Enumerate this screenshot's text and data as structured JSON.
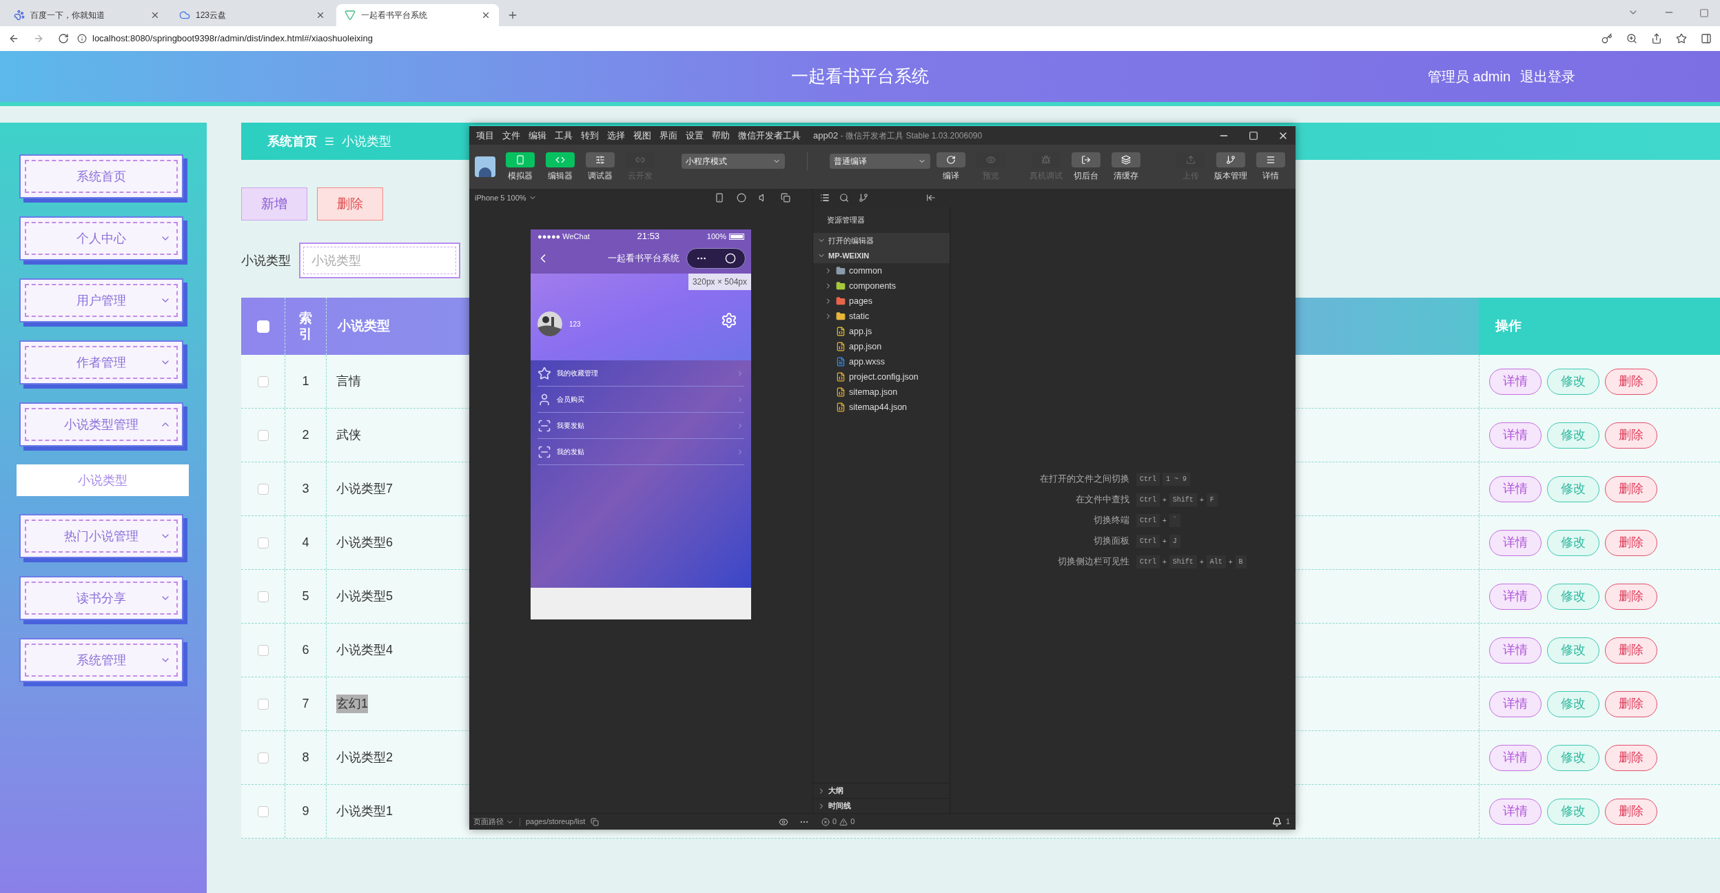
{
  "browser": {
    "tabs": [
      {
        "title": "百度一下，你就知道",
        "selected": false
      },
      {
        "title": "123云盘",
        "selected": false
      },
      {
        "title": "一起看书平台系统",
        "selected": true
      }
    ],
    "address": "localhost:8080/springboot9398r/admin/dist/index.html#/xiaoshuoleixing"
  },
  "header": {
    "title": "一起看书平台系统",
    "user": "管理员 admin",
    "logout": "退出登录"
  },
  "sidebar": {
    "items": [
      {
        "label": "系统首页",
        "kind": "link"
      },
      {
        "label": "个人中心",
        "kind": "menu",
        "expanded": false
      },
      {
        "label": "用户管理",
        "kind": "menu",
        "expanded": false
      },
      {
        "label": "作者管理",
        "kind": "menu",
        "expanded": false
      },
      {
        "label": "小说类型管理",
        "kind": "menu",
        "expanded": true,
        "children": [
          {
            "label": "小说类型",
            "selected": true
          }
        ]
      },
      {
        "label": "热门小说管理",
        "kind": "menu",
        "expanded": false
      },
      {
        "label": "读书分享",
        "kind": "menu",
        "expanded": false
      },
      {
        "label": "系统管理",
        "kind": "menu",
        "expanded": false
      }
    ]
  },
  "breadcrumb": {
    "home": "系统首页",
    "current": "小说类型"
  },
  "actions": [
    {
      "label": "新增",
      "kind": "add"
    },
    {
      "label": "删除",
      "kind": "delete"
    }
  ],
  "search": {
    "label": "小说类型",
    "placeholder": "小说类型"
  },
  "table": {
    "all_checked": false,
    "columns": [
      "索引",
      "小说类型",
      "操作"
    ],
    "rows": [
      {
        "index": "1",
        "type": "言情",
        "checked": false,
        "text_selected": false,
        "actions": [
          "详情",
          "修改",
          "删除"
        ]
      },
      {
        "index": "2",
        "type": "武侠",
        "checked": false,
        "text_selected": false,
        "actions": [
          "详情",
          "修改",
          "删除"
        ]
      },
      {
        "index": "3",
        "type": "小说类型7",
        "checked": false,
        "text_selected": false,
        "actions": [
          "详情",
          "修改",
          "删除"
        ]
      },
      {
        "index": "4",
        "type": "小说类型6",
        "checked": false,
        "text_selected": false,
        "actions": [
          "详情",
          "修改",
          "删除"
        ]
      },
      {
        "index": "5",
        "type": "小说类型5",
        "checked": false,
        "text_selected": false,
        "actions": [
          "详情",
          "修改",
          "删除"
        ]
      },
      {
        "index": "6",
        "type": "小说类型4",
        "checked": false,
        "text_selected": false,
        "actions": [
          "详情",
          "修改",
          "删除"
        ]
      },
      {
        "index": "7",
        "type": "玄幻1",
        "checked": false,
        "text_selected": true,
        "actions": [
          "详情",
          "修改",
          "删除"
        ]
      },
      {
        "index": "8",
        "type": "小说类型2",
        "checked": false,
        "text_selected": false,
        "actions": [
          "详情",
          "修改",
          "删除"
        ]
      },
      {
        "index": "9",
        "type": "小说类型1",
        "checked": false,
        "text_selected": false,
        "actions": [
          "详情",
          "修改",
          "删除"
        ]
      }
    ]
  },
  "devtools": {
    "menu": [
      "项目",
      "文件",
      "编辑",
      "工具",
      "转到",
      "选择",
      "视图",
      "界面",
      "设置",
      "帮助",
      "微信开发者工具"
    ],
    "app": "app02",
    "title_suffix": "- 微信开发者工具 Stable 1.03.2006090",
    "toolbar_left": [
      {
        "label": "模拟器",
        "kind": "simulator",
        "active": true,
        "disabled": false
      },
      {
        "label": "编辑器",
        "kind": "editor",
        "active": true,
        "disabled": false
      },
      {
        "label": "调试器",
        "kind": "debugger",
        "active": false,
        "disabled": false
      },
      {
        "label": "云开发",
        "kind": "cloud",
        "disabled": true
      }
    ],
    "mode": "小程序模式",
    "compile_mode": "普通编译",
    "toolbar_mid": [
      {
        "label": "编译",
        "kind": "compile",
        "disabled": false
      },
      {
        "label": "预览",
        "kind": "preview",
        "disabled": true
      }
    ],
    "toolbar_right": [
      {
        "label": "真机调试",
        "kind": "remote",
        "disabled": true
      },
      {
        "label": "切后台",
        "kind": "background",
        "disabled": false
      },
      {
        "label": "清缓存",
        "kind": "cache",
        "disabled": false
      }
    ],
    "toolbar_end": [
      {
        "label": "上传",
        "kind": "upload",
        "disabled": true
      },
      {
        "label": "版本管理",
        "kind": "version",
        "disabled": false
      },
      {
        "label": "详情",
        "kind": "details",
        "disabled": false
      }
    ],
    "device": "iPhone 5 100%",
    "phone": {
      "carrier": "●●●●● WeChat",
      "time": "21:53",
      "battery": "100%",
      "title": "一起看书平台系统",
      "size_tip": "320px × 504px",
      "user": "123",
      "menu": [
        {
          "label": "我的收藏管理",
          "kind": "star"
        },
        {
          "label": "会员购买",
          "kind": "user"
        },
        {
          "label": "我要发贴",
          "kind": "scan"
        },
        {
          "label": "我的发贴",
          "kind": "scan"
        }
      ]
    },
    "explorer": {
      "title": "资源管理器",
      "open_editors": {
        "label": "打开的编辑器",
        "expanded": true
      },
      "project": {
        "label": "MP-WEIXIN",
        "expanded": true,
        "children": [
          {
            "name": "common",
            "kind": "folder",
            "color": "#8a9bab",
            "expanded": false
          },
          {
            "name": "components",
            "kind": "folder",
            "color": "#a6c93a",
            "expanded": false
          },
          {
            "name": "pages",
            "kind": "folder",
            "color": "#e8654a",
            "expanded": false
          },
          {
            "name": "static",
            "kind": "folder",
            "color": "#e8b53a",
            "expanded": false
          },
          {
            "name": "app.js",
            "kind": "js"
          },
          {
            "name": "app.json",
            "kind": "json"
          },
          {
            "name": "app.wxss",
            "kind": "css"
          },
          {
            "name": "project.config.json",
            "kind": "json"
          },
          {
            "name": "sitemap.json",
            "kind": "json"
          },
          {
            "name": "sitemap44.json",
            "kind": "json"
          }
        ]
      },
      "bottom_sections": [
        {
          "label": "大纲",
          "expanded": false
        },
        {
          "label": "时间线",
          "expanded": false
        }
      ]
    },
    "shortcuts": [
      {
        "label": "在打开的文件之间切换",
        "keys": [
          {
            "text": "Ctrl",
            "kind": "key"
          },
          {
            "text": "1 ~ 9",
            "kind": "key"
          }
        ]
      },
      {
        "label": "在文件中查找",
        "keys": [
          {
            "text": "Ctrl",
            "kind": "key"
          },
          {
            "text": "+",
            "kind": "plus"
          },
          {
            "text": "Shift",
            "kind": "key"
          },
          {
            "text": "+",
            "kind": "plus"
          },
          {
            "text": "F",
            "kind": "key"
          }
        ]
      },
      {
        "label": "切换终端",
        "keys": [
          {
            "text": "Ctrl",
            "kind": "key"
          },
          {
            "text": "+",
            "kind": "plus"
          },
          {
            "text": "`",
            "kind": "key"
          }
        ]
      },
      {
        "label": "切换面板",
        "keys": [
          {
            "text": "Ctrl",
            "kind": "key"
          },
          {
            "text": "+",
            "kind": "plus"
          },
          {
            "text": "J",
            "kind": "key"
          }
        ]
      },
      {
        "label": "切换侧边栏可见性",
        "keys": [
          {
            "text": "Ctrl",
            "kind": "key"
          },
          {
            "text": "+",
            "kind": "plus"
          },
          {
            "text": "Shift",
            "kind": "key"
          },
          {
            "text": "+",
            "kind": "plus"
          },
          {
            "text": "Alt",
            "kind": "key"
          },
          {
            "text": "+",
            "kind": "plus"
          },
          {
            "text": "B",
            "kind": "key"
          }
        ]
      }
    ],
    "status": {
      "path_label": "页面路径",
      "path": "pages/storeup/list",
      "errors": "0",
      "warnings": "0",
      "notifications": "1"
    }
  }
}
